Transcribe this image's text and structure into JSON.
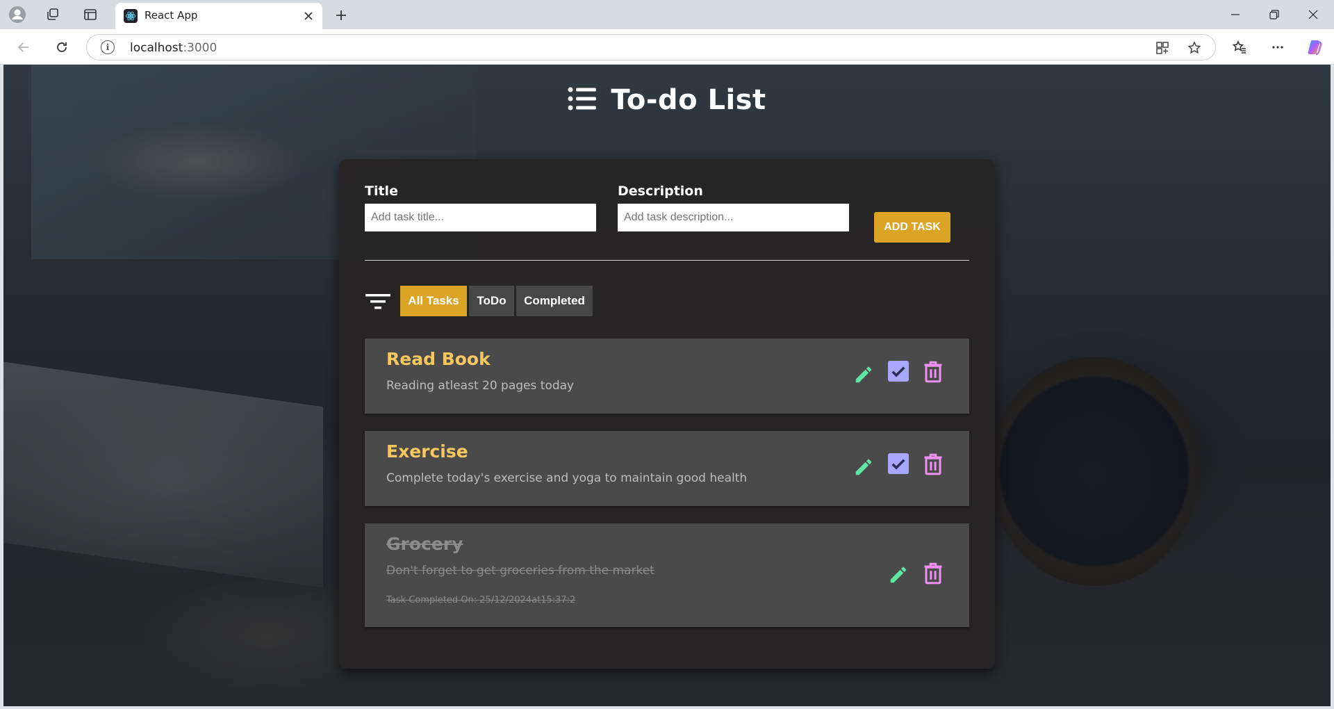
{
  "browser": {
    "tab_title": "React App",
    "url_host": "localhost",
    "url_port": ":3000"
  },
  "app": {
    "title": "To-do List",
    "form": {
      "title_label": "Title",
      "title_placeholder": "Add task title...",
      "title_value": "",
      "description_label": "Description",
      "description_placeholder": "Add task description...",
      "description_value": "",
      "add_button": "ADD TASK"
    },
    "filters": [
      {
        "label": "All Tasks",
        "active": true
      },
      {
        "label": "ToDo",
        "active": false
      },
      {
        "label": "Completed",
        "active": false
      }
    ],
    "tasks": [
      {
        "title": "Read Book",
        "description": "Reading atleast 20 pages today",
        "completed": false
      },
      {
        "title": "Exercise",
        "description": "Complete today's exercise and yoga to maintain good health",
        "completed": false
      },
      {
        "title": "Grocery",
        "description": "Don't forget to get groceries from the market",
        "completed": true,
        "completed_on": "Task Completed On: 25/12/2024at15:37:2"
      }
    ]
  },
  "colors": {
    "accent": "#dca425",
    "task_title": "#f6c85f",
    "edit_icon": "#5ee6a3",
    "check_icon": "#a9a6ff",
    "delete_icon": "#ee90f0"
  },
  "icons": [
    "profile-icon",
    "workspaces-icon",
    "tab-actions-icon",
    "react-logo-icon",
    "close-icon",
    "plus-icon",
    "minimize-icon",
    "restore-icon",
    "window-close-icon",
    "back-icon",
    "refresh-icon",
    "info-icon",
    "app-available-icon",
    "favorite-star-icon",
    "favorites-icon",
    "more-icon",
    "copilot-icon",
    "list-icon",
    "filter-icon",
    "edit-icon",
    "check-icon",
    "delete-icon"
  ]
}
